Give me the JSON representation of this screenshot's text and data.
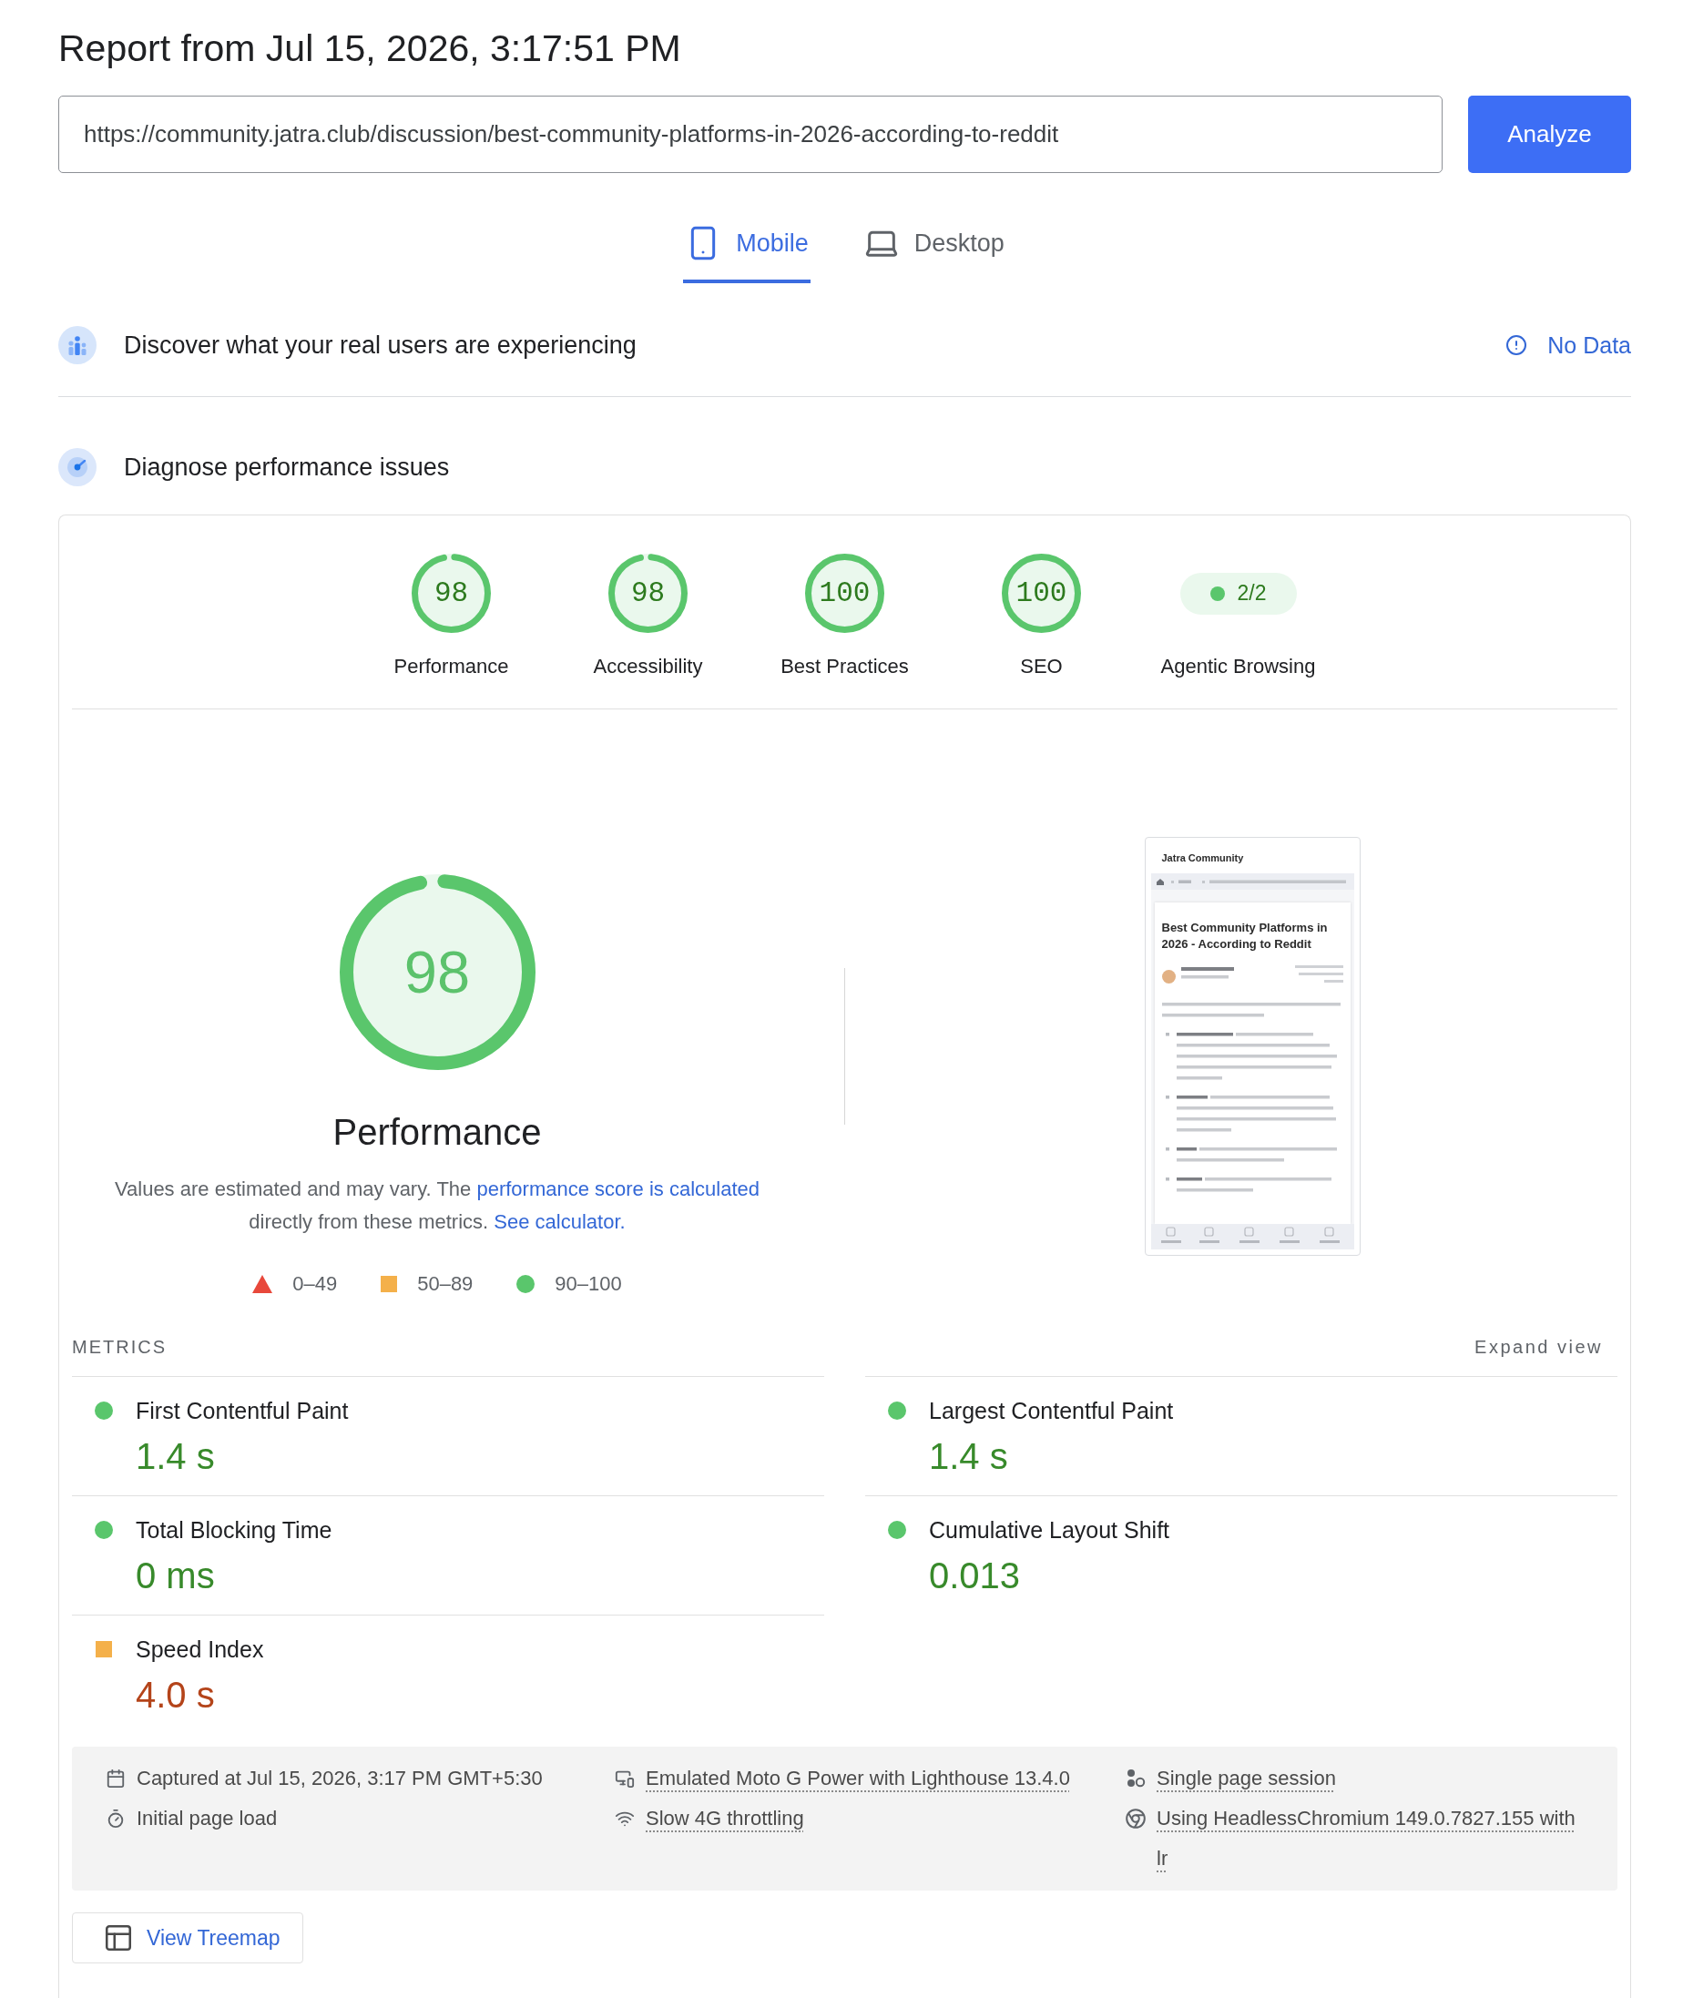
{
  "report_title": "Report from Jul 15, 2026, 3:17:51 PM",
  "url_bar": {
    "value": "https://community.jatra.club/discussion/best-community-platforms-in-2026-according-to-reddit",
    "button": "Analyze"
  },
  "tabs": [
    {
      "label": "Mobile",
      "kind": "mobile",
      "selected": true
    },
    {
      "label": "Desktop",
      "kind": "desktop",
      "selected": false
    }
  ],
  "field_data": {
    "heading": "Discover what your real users are experiencing",
    "status": "No Data"
  },
  "diagnostics": {
    "heading": "Diagnose performance issues",
    "categories": [
      {
        "kind": "gauge",
        "score": "98",
        "level": 0.98,
        "label": "Performance"
      },
      {
        "kind": "gauge",
        "score": "98",
        "level": 0.98,
        "label": "Accessibility"
      },
      {
        "kind": "gauge",
        "score": "100",
        "level": 1,
        "label": "Best Practices"
      },
      {
        "kind": "gauge",
        "score": "100",
        "level": 1,
        "label": "SEO"
      },
      {
        "kind": "fraction",
        "score": "2/2",
        "passed": true,
        "label": "Agentic Browsing"
      }
    ],
    "performance": {
      "score": "98",
      "level": 0.98,
      "title": "Performance",
      "note": [
        {
          "kind": "text",
          "text": "Values are estimated and may vary. The"
        },
        {
          "kind": "link",
          "text": "performance score is calculated"
        },
        {
          "kind": "text",
          "text": "directly from these metrics."
        },
        {
          "kind": "link",
          "text": "See calculator."
        }
      ],
      "legend": [
        {
          "kind": "poor",
          "label": "0–49"
        },
        {
          "kind": "average",
          "label": "50–89"
        },
        {
          "kind": "good",
          "label": "90–100"
        }
      ]
    },
    "screenshot": {
      "site": "Jatra Community",
      "title": "Best Community Platforms in 2026 - According to Reddit"
    },
    "metrics": {
      "heading": "METRICS",
      "toggle": "Expand view",
      "items": [
        {
          "name": "First Contentful Paint",
          "value": "1.4 s",
          "kind": "good"
        },
        {
          "name": "Largest Contentful Paint",
          "value": "1.4 s",
          "kind": "good"
        },
        {
          "name": "Total Blocking Time",
          "value": "0 ms",
          "kind": "good"
        },
        {
          "name": "Cumulative Layout Shift",
          "value": "0.013",
          "kind": "good"
        },
        {
          "name": "Speed Index",
          "value": "4.0 s",
          "kind": "average"
        }
      ]
    },
    "environment": [
      {
        "kind": "captured",
        "text": "Captured at Jul 15, 2026, 3:17 PM GMT+5:30",
        "tooltip": false
      },
      {
        "kind": "device",
        "text": "Emulated Moto G Power with Lighthouse 13.4.0",
        "tooltip": true
      },
      {
        "kind": "session",
        "text": "Single page session",
        "tooltip": true
      },
      {
        "kind": "load",
        "text": "Initial page load",
        "tooltip": false
      },
      {
        "kind": "network",
        "text": "Slow 4G throttling",
        "tooltip": true
      },
      {
        "kind": "browser",
        "text": "Using HeadlessChromium 149.0.7827.155 with lr",
        "tooltip": true
      }
    ],
    "treemap_button": "View Treemap"
  }
}
